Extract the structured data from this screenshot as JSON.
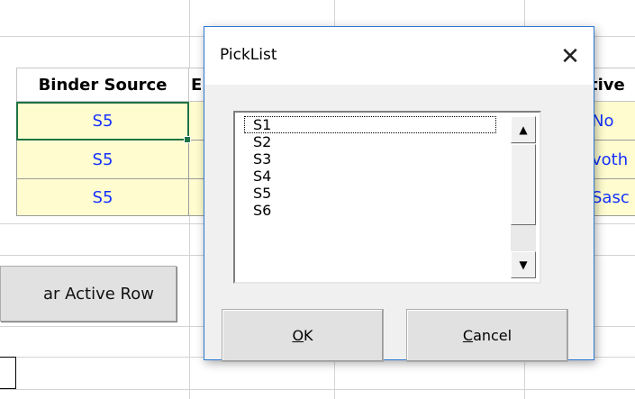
{
  "spreadsheet": {
    "header": {
      "binder_source": "Binder Source",
      "col_b_partial": "E",
      "col_c_partial": "tive"
    },
    "rows": [
      {
        "binder_source": "S5",
        "right_partial": "No"
      },
      {
        "binder_source": "S5",
        "right_partial": "voth"
      },
      {
        "binder_source": "S5",
        "right_partial": "Sasc"
      }
    ],
    "button_label": "ar Active Row"
  },
  "dialog": {
    "title": "PickList",
    "close_label": "✕",
    "list_items": [
      "S1",
      "S2",
      "S3",
      "S4",
      "S5",
      "S6"
    ],
    "ok_mnemonic": "O",
    "ok_rest": "K",
    "cancel_mnemonic": "C",
    "cancel_rest": "ancel"
  },
  "icons": {
    "scroll_up": "▲",
    "scroll_down": "▼"
  },
  "colors": {
    "selection_green": "#217346",
    "cell_text_blue": "#1430ff",
    "cell_fill_yellow": "#fffdcf",
    "dialog_border": "#2b79d2"
  }
}
